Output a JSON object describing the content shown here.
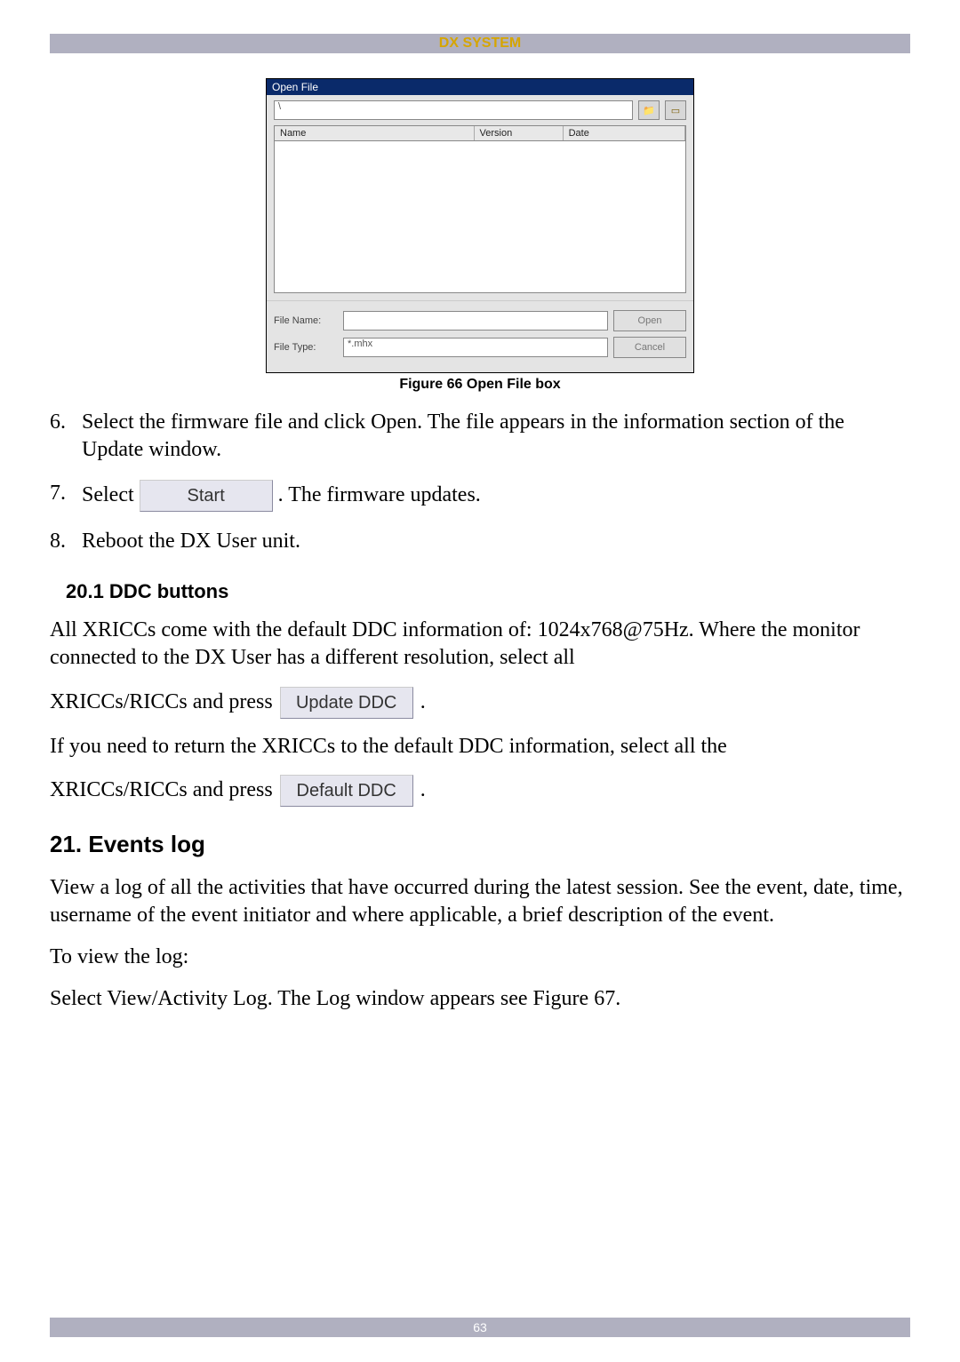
{
  "header": {
    "title": "DX SYSTEM"
  },
  "dialog": {
    "title": "Open File",
    "path": "\\",
    "columns": {
      "name": "Name",
      "version": "Version",
      "date": "Date"
    },
    "file_name_label": "File Name:",
    "file_name_value": "",
    "file_type_label": "File Type:",
    "file_type_value": "*.mhx",
    "open_btn": "Open",
    "cancel_btn": "Cancel"
  },
  "figure_caption": "Figure 66 Open File box",
  "steps": {
    "s6_num": "6.",
    "s6_text": "Select the firmware file and click Open. The file appears in the information section of the Update window.",
    "s7_num": "7.",
    "s7_before": "Select",
    "s7_btn": "Start",
    "s7_after": ". The firmware updates.",
    "s8_num": "8.",
    "s8_text": "Reboot the DX User unit."
  },
  "section_20_1": {
    "heading": "20.1 DDC buttons",
    "p1a": "All XRICCs come with the default DDC information of: 1024x768@75Hz. Where the monitor connected to the DX User has a different resolution, select all",
    "p1b_before": "XRICCs/RICCs and press",
    "update_btn": "Update DDC",
    "p1b_after": ".",
    "p2": "If you need to return the XRICCs to the default DDC information, select all the",
    "p3_before": "XRICCs/RICCs and press",
    "default_btn": "Default DDC",
    "p3_after": "."
  },
  "section_21": {
    "heading": "21. Events log",
    "p1": "View a log of all the activities that have occurred during the latest session. See the event, date, time, username of the event initiator and where applicable, a brief description of the event.",
    "p2": "To view the log:",
    "p3": "Select View/Activity Log. The Log window appears see Figure 67."
  },
  "footer": {
    "page_number": "63"
  }
}
